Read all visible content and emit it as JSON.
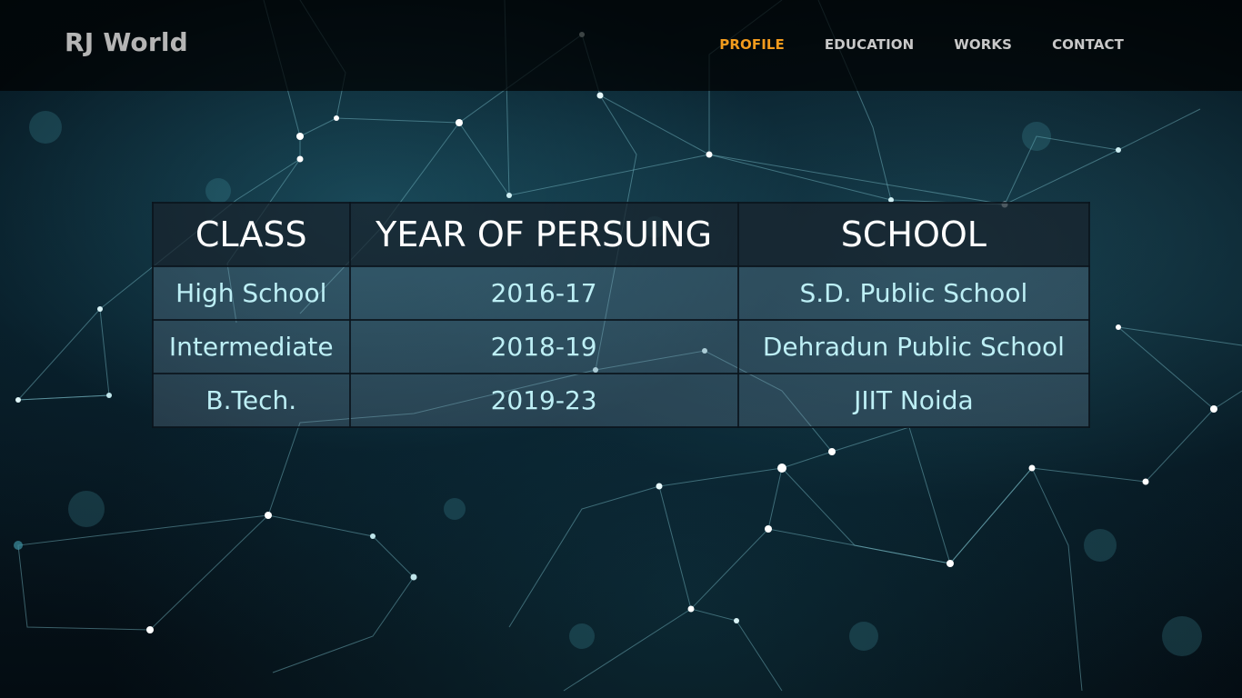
{
  "brand": {
    "name": "RJ World"
  },
  "nav": {
    "items": [
      {
        "label": "PROFILE",
        "active": true
      },
      {
        "label": "EDUCATION",
        "active": false
      },
      {
        "label": "WORKS",
        "active": false
      },
      {
        "label": "CONTACT",
        "active": false
      }
    ]
  },
  "colors": {
    "accent": "#f29b1d",
    "cell_text": "#bdeff5",
    "header_text": "#ffffff"
  },
  "education_table": {
    "headers": [
      "CLASS",
      "YEAR OF PERSUING",
      "SCHOOL"
    ],
    "rows": [
      [
        "High School",
        "2016-17",
        "S.D. Public School"
      ],
      [
        "Intermediate",
        "2018-19",
        "Dehradun Public School"
      ],
      [
        "B.Tech.",
        "2019-23",
        "JIIT Noida"
      ]
    ]
  }
}
